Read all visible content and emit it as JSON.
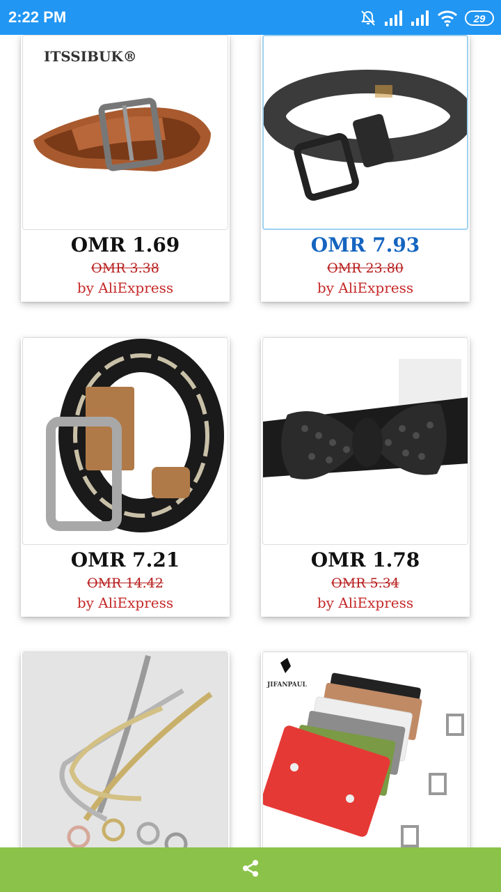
{
  "status_bar": {
    "time": "2:22 PM",
    "battery": "29",
    "icons": [
      "mute-icon",
      "signal-icon",
      "signal-icon",
      "wifi-icon",
      "battery-icon"
    ]
  },
  "products": [
    {
      "price": "OMR 1.69",
      "old_price": "OMR 3.38",
      "seller": "by AliExpress",
      "image": "brown-leather-belt",
      "brand": "ITSSIBUK®"
    },
    {
      "price": "OMR 7.93",
      "old_price": "OMR 23.80",
      "seller": "by AliExpress",
      "image": "black-nylon-tactical-belt"
    },
    {
      "price": "OMR 7.21",
      "old_price": "OMR 14.42",
      "seller": "by AliExpress",
      "image": "canvas-striped-belt"
    },
    {
      "price": "OMR 1.78",
      "old_price": "OMR 5.34",
      "seller": "by AliExpress",
      "image": "black-bow-elastic-belt"
    },
    {
      "image": "metal-bow-skinny-belts"
    },
    {
      "image": "waist-bag-belts",
      "brand": "JIFANPAUL"
    }
  ],
  "colors": {
    "status_bar": "#2196f3",
    "bottom_bar": "#8bc34a",
    "selected_price": "#1565c0",
    "old_price": "#b71c1c",
    "seller": "#c62828"
  },
  "bottom_bar": {
    "icon": "share-icon"
  }
}
